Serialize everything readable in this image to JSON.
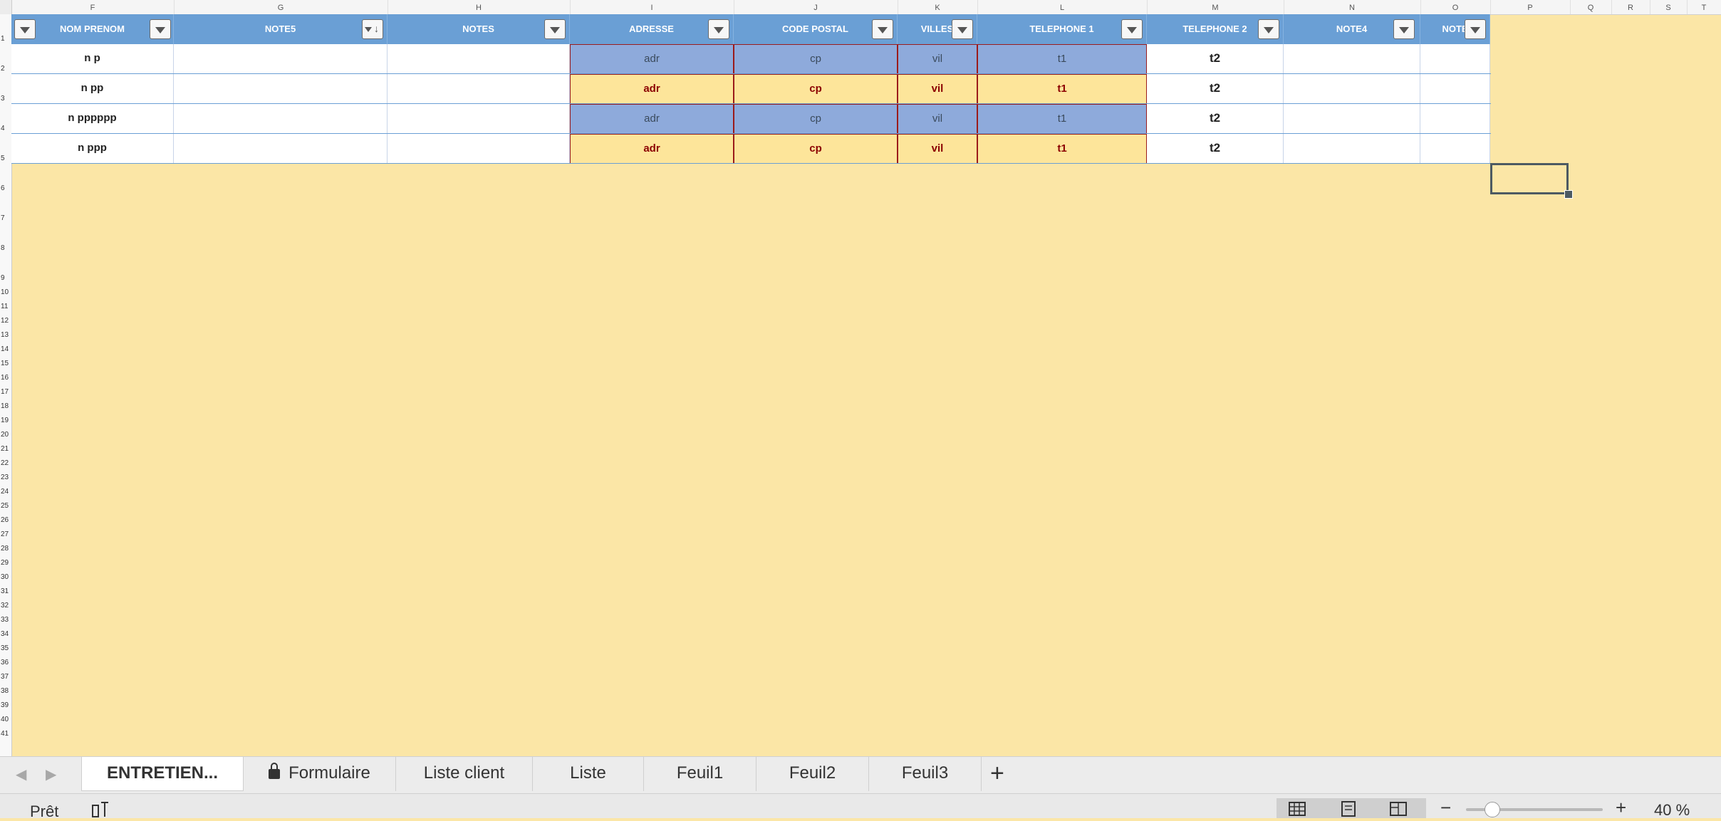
{
  "columns": [
    "F",
    "G",
    "H",
    "I",
    "J",
    "K",
    "L",
    "M",
    "N",
    "O",
    "P",
    "Q",
    "R",
    "S",
    "T"
  ],
  "row_numbers": [
    "1",
    "2",
    "3",
    "4",
    "5",
    "6",
    "7",
    "8",
    "9",
    "10",
    "11",
    "12",
    "13",
    "14",
    "15",
    "16",
    "17",
    "18",
    "19",
    "20",
    "21",
    "22",
    "23",
    "24",
    "25",
    "26",
    "27",
    "28",
    "29",
    "30",
    "31",
    "32",
    "33",
    "34",
    "35",
    "36",
    "37",
    "38",
    "39",
    "40",
    "41"
  ],
  "table": {
    "headers": [
      "NOM PRENOM",
      "NOTE5",
      "NOTES",
      "ADRESSE",
      "CODE POSTAL",
      "VILLES",
      "TELEPHONE 1",
      "TELEPHONE 2",
      "NOTE4",
      "NOTE"
    ],
    "rows": [
      [
        "n p",
        "",
        "",
        "adr",
        "cp",
        "vil",
        "t1",
        "t2",
        "",
        ""
      ],
      [
        "n pp",
        "",
        "",
        "adr",
        "cp",
        "vil",
        "t1",
        "t2",
        "",
        ""
      ],
      [
        "n pppppp",
        "",
        "",
        "adr",
        "cp",
        "vil",
        "t1",
        "t2",
        "",
        ""
      ],
      [
        "n ppp",
        "",
        "",
        "adr",
        "cp",
        "vil",
        "t1",
        "t2",
        "",
        ""
      ]
    ]
  },
  "colors": {
    "header_bg": "#6a9fd5",
    "band_blue": "#8eaadb",
    "band_yellow": "#fde59a",
    "cell_border_red": "#9b1b1b",
    "sheet_bg": "#fbe6a6"
  },
  "sheet_tabs": [
    "ENTRETIEN...",
    "Formulaire",
    "Liste client",
    "Liste",
    "Feuil1",
    "Feuil2",
    "Feuil3"
  ],
  "active_tab": "ENTRETIEN...",
  "tab_icons": {
    "add_sheet": "plus-icon",
    "locked_sheet": "lock-icon"
  },
  "status": {
    "text": "Prêt",
    "zoom_minus": "−",
    "zoom_plus": "+",
    "zoom": "40 %"
  }
}
